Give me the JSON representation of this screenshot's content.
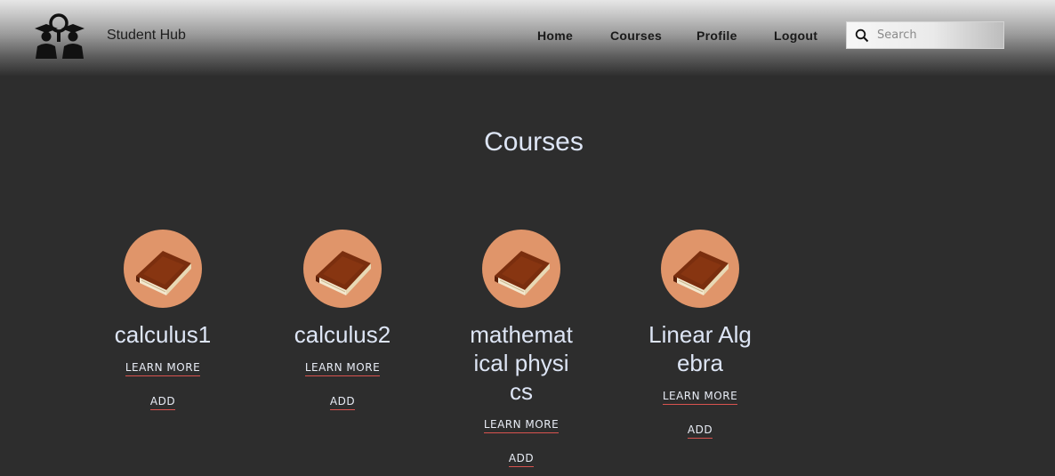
{
  "header": {
    "brand": "Student Hub",
    "nav": [
      "Home",
      "Courses",
      "Profile",
      "Logout"
    ],
    "search_placeholder": "Search",
    "logo_icon": "graduates-search-icon"
  },
  "page": {
    "title": "Courses"
  },
  "courses": [
    {
      "name": "calculus1",
      "learn_label": "LEARN MORE",
      "add_label": "ADD"
    },
    {
      "name": "calculus2",
      "learn_label": "LEARN MORE",
      "add_label": "ADD"
    },
    {
      "name": "mathematical physics",
      "learn_label": "LEARN MORE",
      "add_label": "ADD"
    },
    {
      "name": "Linear Algebra",
      "learn_label": "LEARN MORE",
      "add_label": "ADD"
    }
  ],
  "colors": {
    "background": "#2d2d2d",
    "thumb": "#e0956a",
    "text": "#dde5f5",
    "underline": "#d9534f"
  },
  "icons": {
    "course": "book-icon",
    "search": "search-icon"
  }
}
